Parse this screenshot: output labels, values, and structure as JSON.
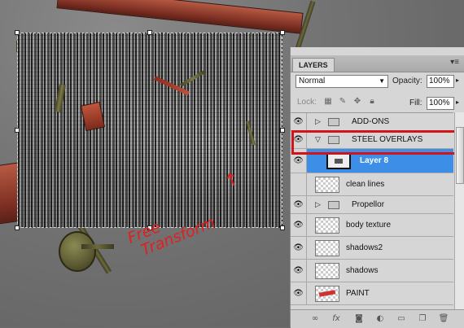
{
  "panel": {
    "tab_label": "LAYERS",
    "blend_mode": "Normal",
    "opacity_label": "Opacity:",
    "opacity_value": "100%",
    "lock_label": "Lock:",
    "fill_label": "Fill:",
    "fill_value": "100%"
  },
  "layers": [
    {
      "name": "ADD-ONS",
      "kind": "group",
      "expanded": false
    },
    {
      "name": "STEEL OVERLAYS",
      "kind": "group",
      "expanded": true
    },
    {
      "name": "Layer 8",
      "kind": "layer",
      "selected": true
    },
    {
      "name": "clean lines",
      "kind": "layer"
    },
    {
      "name": "Propellor",
      "kind": "group",
      "expanded": false
    },
    {
      "name": "body texture",
      "kind": "layer"
    },
    {
      "name": "shadows2",
      "kind": "layer"
    },
    {
      "name": "shadows",
      "kind": "layer"
    },
    {
      "name": "PAINT",
      "kind": "layer"
    }
  ],
  "canvas": {
    "annotation_line1": "Free",
    "annotation_line2": "Transform"
  },
  "icons": {
    "eye": "eye-icon",
    "folder": "folder-icon",
    "bottom_bar": [
      "link-layers-icon",
      "fx-icon",
      "layer-mask-icon",
      "adjustment-layer-icon",
      "new-group-icon",
      "new-layer-icon",
      "delete-layer-icon"
    ]
  },
  "colors": {
    "selection_highlight": "#3c8ee6",
    "callout_outline": "#d0141a",
    "annotation": "#e02020"
  }
}
